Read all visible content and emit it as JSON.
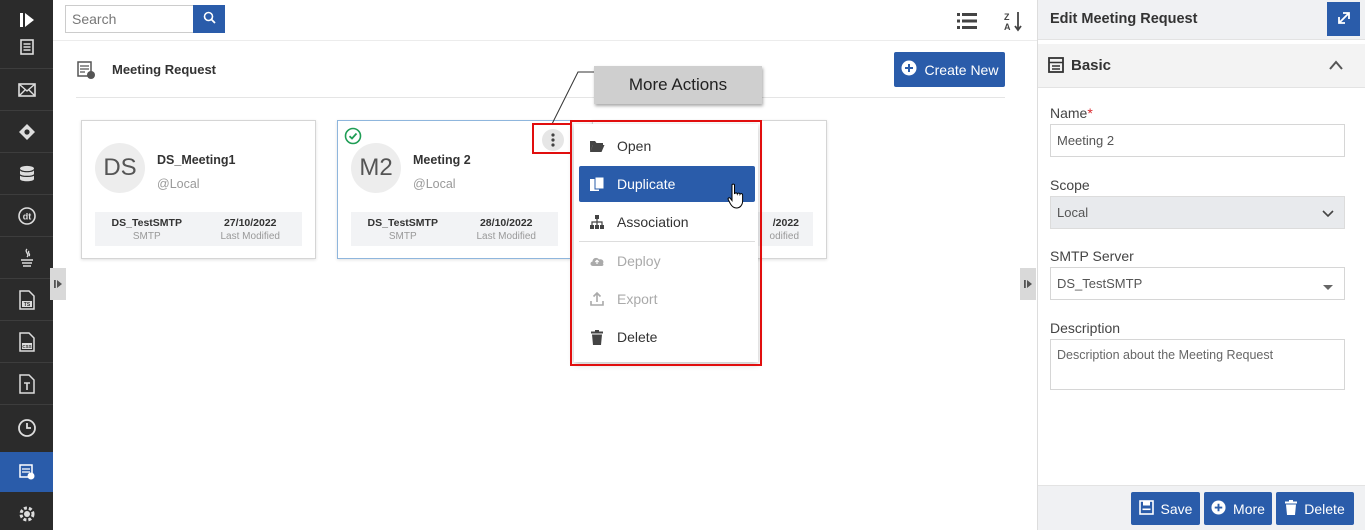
{
  "rail": {
    "items": [
      {
        "icon": "collapse-arrow-icon"
      },
      {
        "icon": "document-list-icon"
      },
      {
        "icon": "envelope-icon"
      },
      {
        "icon": "diamond-icon"
      },
      {
        "icon": "database-icon"
      },
      {
        "icon": "dt-icon"
      },
      {
        "icon": "java-icon"
      },
      {
        "icon": "ts-file-icon"
      },
      {
        "icon": "css-file-icon"
      },
      {
        "icon": "text-file-icon"
      },
      {
        "icon": "clock-icon"
      },
      {
        "icon": "meeting-request-icon"
      },
      {
        "icon": "settings-gear-icon"
      }
    ]
  },
  "search": {
    "placeholder": "Search"
  },
  "page": {
    "title": "Meeting Request",
    "create_label": "Create New"
  },
  "cards": [
    {
      "initials": "DS",
      "name": "DS_Meeting1",
      "scope": "@Local",
      "server": "DS_TestSMTP",
      "server_label": "SMTP",
      "date": "27/10/2022",
      "date_label": "Last Modified"
    },
    {
      "initials": "M2",
      "name": "Meeting 2",
      "scope": "@Local",
      "server": "DS_TestSMTP",
      "server_label": "SMTP",
      "date": "28/10/2022",
      "date_label": "Last Modified"
    },
    {
      "date_partial": "/2022",
      "date_label_partial": "odified"
    }
  ],
  "callout": {
    "text": "More Actions"
  },
  "menu": {
    "items": [
      {
        "label": "Open",
        "icon": "folder-open-icon",
        "state": "normal"
      },
      {
        "label": "Duplicate",
        "icon": "copy-icon",
        "state": "active"
      },
      {
        "label": "Association",
        "icon": "sitemap-icon",
        "state": "normal"
      },
      {
        "label": "Deploy",
        "icon": "cloud-upload-icon",
        "state": "disabled"
      },
      {
        "label": "Export",
        "icon": "export-icon",
        "state": "disabled"
      },
      {
        "label": "Delete",
        "icon": "trash-icon",
        "state": "normal"
      }
    ]
  },
  "panel": {
    "title": "Edit Meeting Request",
    "section": "Basic",
    "name_label": "Name",
    "name_required": "*",
    "name_value": "Meeting 2",
    "scope_label": "Scope",
    "scope_value": "Local",
    "smtp_label": "SMTP Server",
    "smtp_value": "DS_TestSMTP",
    "description_label": "Description",
    "description_placeholder": "Description about the Meeting Request",
    "save_label": "Save",
    "more_label": "More",
    "delete_label": "Delete"
  },
  "colors": {
    "accent": "#2a5caa",
    "rail": "#2b2b2b",
    "highlight": "#e10e0e",
    "success": "#1f9d55"
  }
}
